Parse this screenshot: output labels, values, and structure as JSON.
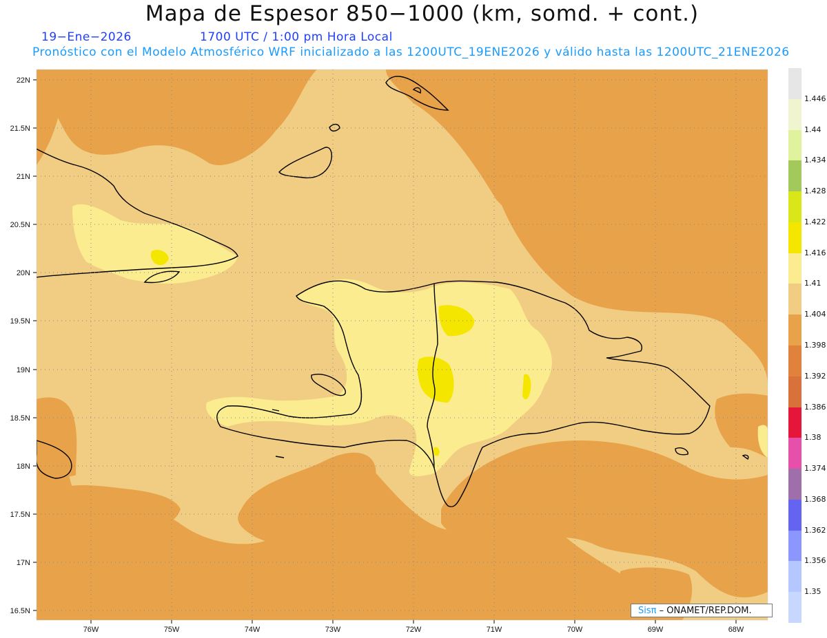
{
  "header": {
    "title": "Mapa de Espesor 850−1000 (km, somd. + cont.)",
    "date": "19−Ene−2026",
    "time": "1700 UTC / 1:00 pm Hora Local",
    "subtitle": "Pronóstico con el Modelo Atmosférico WRF inicializado a las 1200UTC_19ENE2026 y válido hasta las  1200UTC_21ENE2026"
  },
  "axes": {
    "lat_labels": [
      "22N",
      "21.5N",
      "21N",
      "20.5N",
      "20N",
      "19.5N",
      "19N",
      "18.5N",
      "18N",
      "17.5N",
      "17N",
      "16.5N"
    ],
    "lon_labels": [
      "76W",
      "75W",
      "74W",
      "73W",
      "72W",
      "71W",
      "70W",
      "69W",
      "68W"
    ]
  },
  "colorbar": {
    "levels": [
      "1.446",
      "1.44",
      "1.434",
      "1.428",
      "1.422",
      "1.416",
      "1.41",
      "1.404",
      "1.398",
      "1.392",
      "1.386",
      "1.38",
      "1.374",
      "1.368",
      "1.362",
      "1.356",
      "1.35"
    ],
    "colors": [
      "#e6e6e6",
      "#f0f5d0",
      "#e1f29e",
      "#a3c95a",
      "#d9e61a",
      "#f5e600",
      "#faec8f",
      "#f0cd82",
      "#e8a24a",
      "#e0823c",
      "#d9723a",
      "#e6163a",
      "#e64faa",
      "#9e6faa",
      "#6464f0",
      "#8c96ff",
      "#b4c8ff",
      "#c8d7ff"
    ]
  },
  "colors": {
    "sea": "#e8a24a",
    "land_mid": "#f0cd82",
    "land_light": "#faec8f",
    "max_yellow": "#f5e600",
    "coast": "#000000"
  },
  "credit": {
    "brand": "Sisπ",
    "text": "– ONAMET/REP.DOM."
  }
}
